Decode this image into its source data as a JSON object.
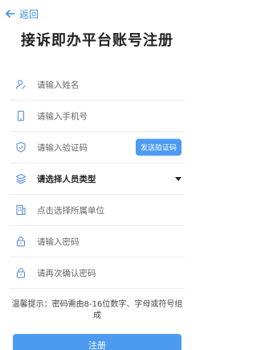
{
  "header": {
    "back_label": "返回",
    "title": "接诉即办平台账号注册"
  },
  "form": {
    "fields": [
      {
        "name": "name",
        "icon": "user-edit-icon",
        "placeholder": "请输入姓名"
      },
      {
        "name": "phone",
        "icon": "phone-icon",
        "placeholder": "请输入手机号"
      },
      {
        "name": "code",
        "icon": "shield-check-icon",
        "placeholder": "请输入验证码"
      },
      {
        "name": "type",
        "icon": "layers-icon",
        "placeholder": "请选择人员类型"
      },
      {
        "name": "unit",
        "icon": "building-icon",
        "placeholder": "点击选择所属单位"
      },
      {
        "name": "password",
        "icon": "lock-icon",
        "placeholder": "请输入密码"
      },
      {
        "name": "password_confirm",
        "icon": "lock-icon",
        "placeholder": "请再次确认密码"
      }
    ],
    "send_code_label": "发送验证码"
  },
  "tip": "温馨提示：密码需由8-16位数字、字母或符号组成",
  "submit_label": "注册",
  "colors": {
    "accent": "#4c9bf0",
    "back": "#3a8ee6"
  }
}
